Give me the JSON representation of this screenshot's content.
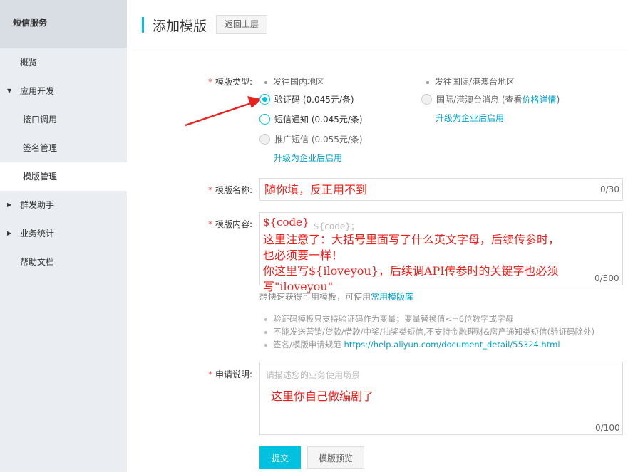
{
  "sidebar": {
    "header": "短信服务",
    "items": [
      {
        "label": "概览"
      },
      {
        "label": "应用开发"
      },
      {
        "label": "接口调用"
      },
      {
        "label": "签名管理"
      },
      {
        "label": "模版管理"
      },
      {
        "label": "群发助手"
      },
      {
        "label": "业务统计"
      },
      {
        "label": "帮助文档"
      }
    ]
  },
  "header": {
    "title": "添加模版",
    "back_label": "返回上层"
  },
  "form": {
    "type_label": "模版类型:",
    "domestic_head": "发往国内地区",
    "intl_head": "发往国际/港澳台地区",
    "options": [
      {
        "label": "验证码 (0.045元/条)"
      },
      {
        "label": "短信通知 (0.045元/条)"
      },
      {
        "label": "推广短信 (0.055元/条)"
      }
    ],
    "intl_option_prefix": "国际/港澳台消息 (查看",
    "intl_option_link": "价格详情",
    "intl_option_suffix": ")",
    "upgrade_domestic": "升级为企业后启用",
    "upgrade_intl": "升级为企业后启用",
    "name_label": "模版名称:",
    "name_value": "随你填，反正用不到",
    "name_counter": "0/30",
    "content_label": "模版内容:",
    "content_value": "${code}",
    "content_placeholder": "${code}；",
    "content_counter": "0/500",
    "content_note_line1": "这里注意了：大括号里面写了什么英文字母，后续传参时，",
    "content_note_line2": "也必须要一样！",
    "content_note_line3": "你这里写${iloveyou}，后续调API传参时的关键字也必须",
    "content_note_line4": "写\"iloveyou\"",
    "library_hint_prefix": "想快速获得可用模板，可使用",
    "library_link": "常用模版库",
    "rules": [
      "验证码模板只支持验证码作为变量；变量替换值<=6位数字或字母",
      "不能发送营销/贷款/借款/中奖/抽奖类短信,不支持金融理财&房产通知类短信(验证码除外)"
    ],
    "rule3_prefix": "签名/模版申请规范 ",
    "rule3_url": "https://help.aliyun.com/document_detail/55324.html",
    "desc_label": "申请说明:",
    "desc_placeholder": "请描述您的业务使用场景",
    "desc_note": "这里你自己做编剧了",
    "desc_counter": "0/100",
    "submit_label": "提交",
    "preview_label": "模版预览"
  }
}
